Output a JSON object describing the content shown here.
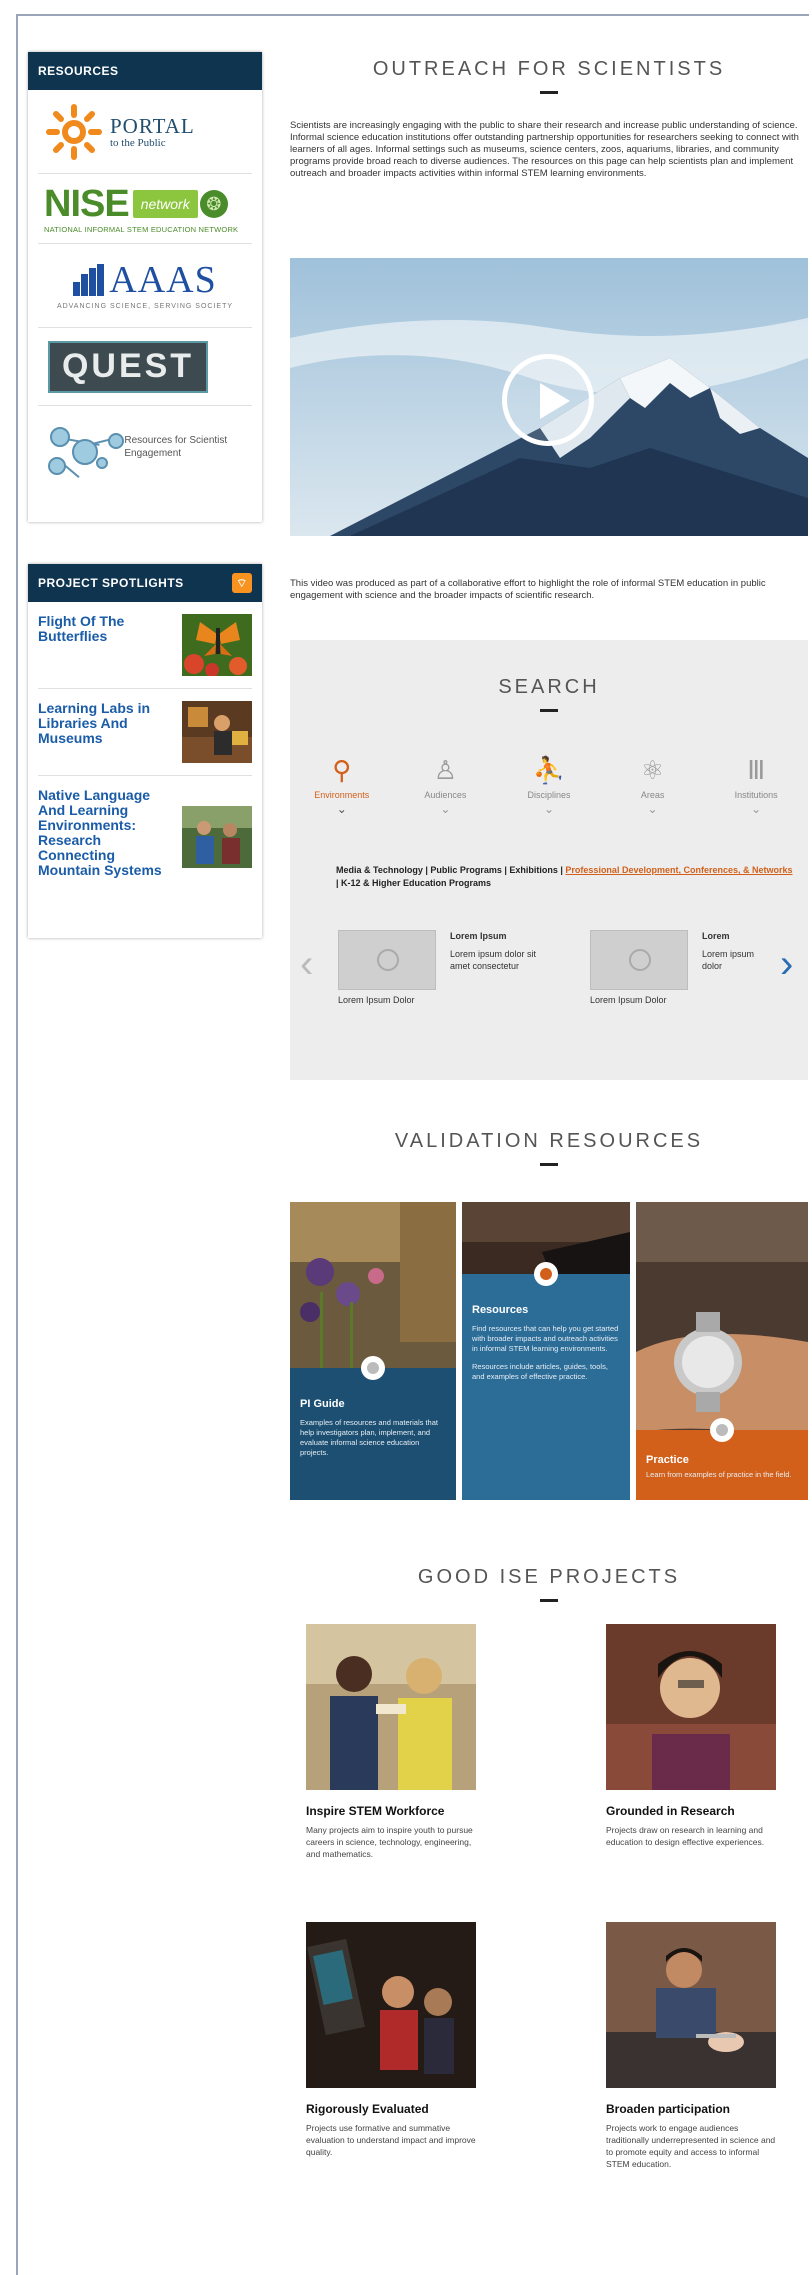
{
  "sidebar": {
    "resources": {
      "heading": "RESOURCES",
      "portal": {
        "big": "PORTAL",
        "small": "to the Public"
      },
      "nise": {
        "word": "NISE",
        "net": "network",
        "tagline": "NATIONAL INFORMAL STEM EDUCATION NETWORK"
      },
      "aaas": {
        "word": "AAAS",
        "tagline": "ADVANCING SCIENCE, SERVING SOCIETY"
      },
      "quest": {
        "word": "QUEST"
      },
      "partner": {
        "text": "Resources for Scientist Engagement"
      }
    },
    "spotlights": {
      "heading": "PROJECT SPOTLIGHTS",
      "items": [
        {
          "title": "Flight Of The Butterflies"
        },
        {
          "title": "Learning Labs in Libraries And Museums"
        },
        {
          "title": "Native Language And Learning Environments: Research Connecting Mountain Systems"
        }
      ]
    }
  },
  "outreach": {
    "title": "OUTREACH FOR SCIENTISTS",
    "paragraph": "Scientists are increasingly engaging with the public to share their research and increase public understanding of science. Informal science education institutions offer outstanding partnership opportunities for researchers seeking to connect with learners of all ages. Informal settings such as museums, science centers, zoos, aquariums, libraries, and community programs provide broad reach to diverse audiences. The resources on this page can help scientists plan and implement outreach and broader impacts activities within informal STEM learning environments.",
    "video_caption": "This video was produced as part of a collaborative effort to highlight the role of informal STEM education in public engagement with science and the broader impacts of scientific research."
  },
  "search": {
    "title": "SEARCH",
    "categories": [
      {
        "label": "Environments",
        "icon": "lightbulb-icon",
        "active": true
      },
      {
        "label": "Audiences",
        "icon": "person-icon",
        "active": false
      },
      {
        "label": "Disciplines",
        "icon": "runner-icon",
        "active": false
      },
      {
        "label": "Areas",
        "icon": "atom-icon",
        "active": false
      },
      {
        "label": "Institutions",
        "icon": "column-icon",
        "active": false
      }
    ],
    "subcategories": {
      "plain": "Media & Technology | Public Programs | Exhibitions | ",
      "highlight": "Professional Development, Conferences, & Networks",
      "rest": " | K-12 & Higher Education Programs"
    },
    "carousel": [
      {
        "title": "Lorem Ipsum Dolor",
        "subtitle": ""
      },
      {
        "title": "Lorem Ipsum",
        "subtitle": "Lorem ipsum dolor sit amet consectetur"
      },
      {
        "title": "Lorem Ipsum Dolor",
        "subtitle": ""
      },
      {
        "title": "Lorem",
        "subtitle": "Lorem ipsum dolor"
      }
    ]
  },
  "validation": {
    "title": "VALIDATION RESOURCES",
    "cards": [
      {
        "title": "PI Guide",
        "text": "Examples of resources and materials that help investigators plan, implement, and evaluate informal science education projects."
      },
      {
        "title": "Resources",
        "text": "Find resources that can help you get started with broader impacts and outreach activities in informal STEM learning environments.",
        "text2": "Resources include articles, guides, tools, and examples of effective practice."
      },
      {
        "title": "Practice",
        "text": "Learn from examples of practice in the field."
      }
    ]
  },
  "projects": {
    "title": "GOOD ISE PROJECTS",
    "items": [
      {
        "title": "Inspire STEM Workforce",
        "text": "Many projects aim to inspire youth to pursue careers in science, technology, engineering, and mathematics."
      },
      {
        "title": "Grounded in Research",
        "text": "Projects draw on research in learning and education to design effective experiences."
      },
      {
        "title": "Rigorously Evaluated",
        "text": "Projects use formative and summative evaluation to understand impact and improve quality."
      },
      {
        "title": "Broaden participation",
        "text": "Projects work to engage audiences traditionally underrepresented in science and to promote equity and access to informal STEM education."
      }
    ]
  }
}
